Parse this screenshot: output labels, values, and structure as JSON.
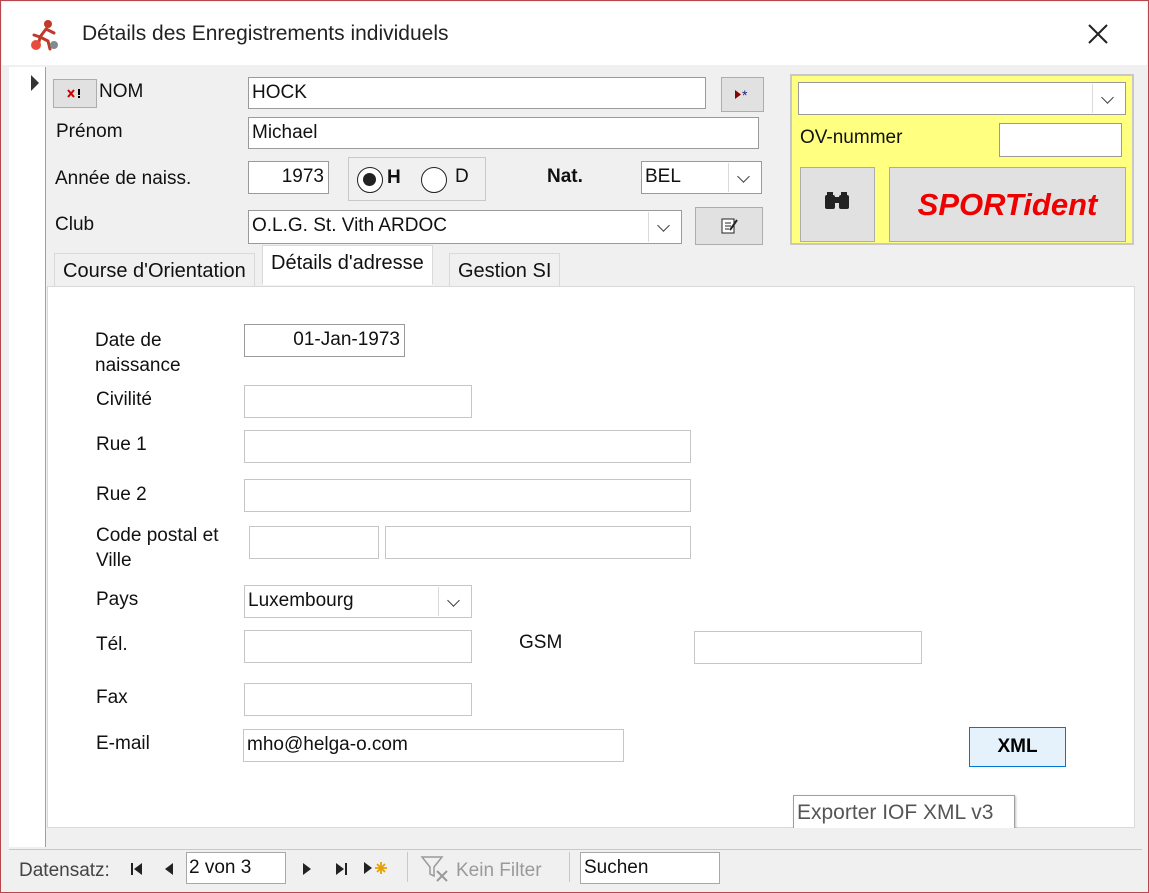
{
  "window": {
    "title": "Détails des Enregistrements individuels"
  },
  "header": {
    "nom_label": "NOM",
    "nom_value": "HOCK",
    "prenom_label": "Prénom",
    "prenom_value": "Michael",
    "annee_label": "Année de naiss.",
    "annee_value": "1973",
    "sex_h_label": "H",
    "sex_d_label": "D",
    "sex_selected": "H",
    "nat_label": "Nat.",
    "nat_value": "BEL",
    "club_label": "Club",
    "club_value": "O.L.G. St. Vith ARDOC",
    "ov_label": "OV-nummer",
    "ov_value": "",
    "top_combo_value": "",
    "sportident_label": "SPORTident",
    "accent_color": "#ffff80",
    "sportident_color": "#ee0000"
  },
  "tabs": [
    {
      "label": "Course d'Orientation",
      "active": false
    },
    {
      "label": "Détails d'adresse",
      "active": true
    },
    {
      "label": "Gestion SI",
      "active": false
    }
  ],
  "address": {
    "dob_label": "Date de naissance",
    "dob_value": "01-Jan-1973",
    "civilite_label": "Civilité",
    "civilite_value": "",
    "rue1_label": "Rue 1",
    "rue1_value": "",
    "rue2_label": "Rue 2",
    "rue2_value": "",
    "cp_label": "Code postal et Ville",
    "cp_value": "",
    "ville_value": "",
    "pays_label": "Pays",
    "pays_value": "Luxembourg",
    "tel_label": "Tél.",
    "tel_value": "",
    "gsm_label": "GSM",
    "gsm_value": "",
    "fax_label": "Fax",
    "fax_value": "",
    "email_label": "E-mail",
    "email_value": "mho@helga-o.com",
    "xml_button": "XML",
    "xml_tooltip": "Exporter IOF XML v3"
  },
  "navigation": {
    "record_label": "Datensatz:",
    "record_position": "2 von 3",
    "filter_label": "Kein Filter",
    "search_placeholder": "Suchen"
  }
}
